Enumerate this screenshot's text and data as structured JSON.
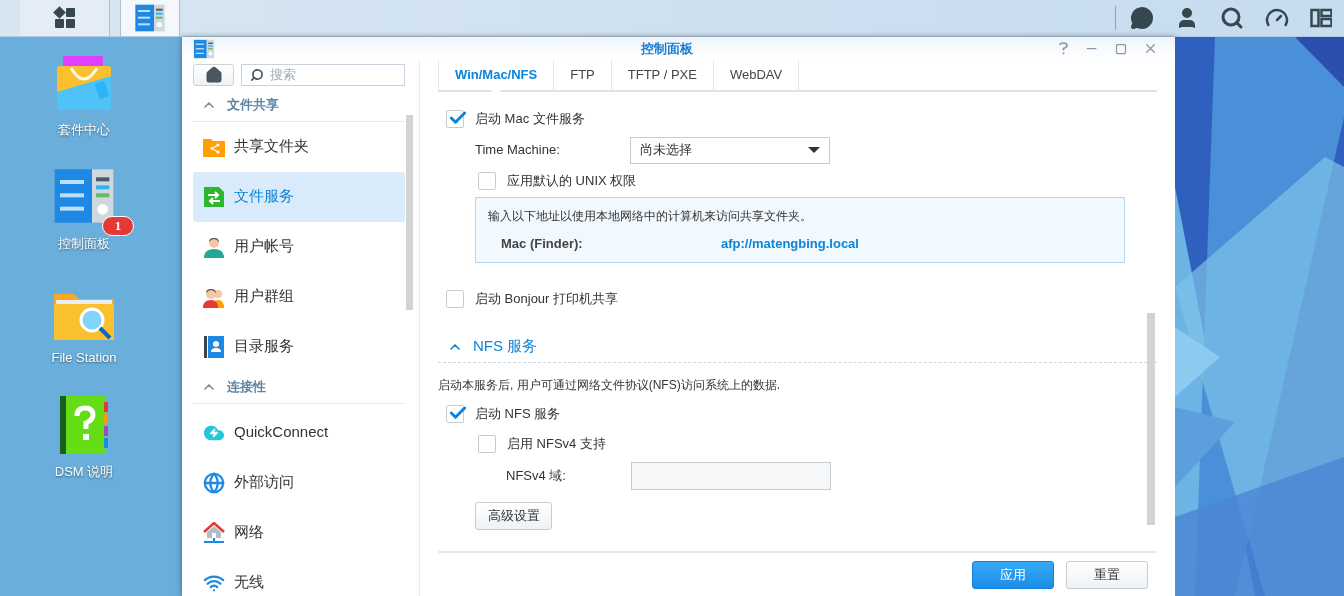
{
  "taskbar": {
    "left_buttons": [
      {
        "kind": "main-menu",
        "selected": false
      },
      {
        "kind": "control-panel",
        "selected": true
      }
    ]
  },
  "desktop_icons": [
    {
      "kind": "package",
      "label": "套件中心"
    },
    {
      "kind": "control",
      "label": "控制面板",
      "badge": "1"
    },
    {
      "kind": "folder",
      "label": "File Station"
    },
    {
      "kind": "help",
      "label": "DSM 说明"
    }
  ],
  "window": {
    "title": "控制面板"
  },
  "sidebar": {
    "search": {
      "placeholder": "搜索"
    },
    "sections": [
      {
        "title": "文件共享",
        "expanded": true,
        "items": [
          {
            "label": "共享文件夹",
            "selected": false
          },
          {
            "label": "文件服务",
            "selected": true
          },
          {
            "label": "用户帐号",
            "selected": false
          },
          {
            "label": "用户群组",
            "selected": false
          },
          {
            "label": "目录服务",
            "selected": false
          }
        ]
      },
      {
        "title": "连接性",
        "expanded": true,
        "items": [
          {
            "label": "QuickConnect",
            "selected": false
          },
          {
            "label": "外部访问",
            "selected": false
          },
          {
            "label": "网络",
            "selected": false
          },
          {
            "label": "无线",
            "selected": false
          }
        ]
      }
    ]
  },
  "tabs": [
    {
      "label": "Win/Mac/NFS",
      "selected": true
    },
    {
      "label": "FTP",
      "selected": false
    },
    {
      "label": "TFTP / PXE",
      "selected": false
    },
    {
      "label": "WebDAV",
      "selected": false
    }
  ],
  "mac": {
    "enable": {
      "label": "启动 Mac 文件服务",
      "checked": true
    },
    "time_machine": {
      "label": "Time Machine:",
      "value": "尚未选择"
    },
    "unix": {
      "label": "应用默认的 UNIX 权限",
      "checked": false
    },
    "info": {
      "text": "输入以下地址以使用本地网络中的计算机来访问共享文件夹。",
      "key": "Mac (Finder):",
      "value": "afp://matengbing.local"
    }
  },
  "bonjour": {
    "label": "启动 Bonjour 打印机共享",
    "checked": false
  },
  "nfs": {
    "title": "NFS 服务",
    "expanded": true,
    "description": "启动本服务后, 用户可通过网络文件协议(NFS)访问系统上的数据.",
    "enable": {
      "label": "启动 NFS 服务",
      "checked": true
    },
    "v4": {
      "label": "启用 NFSv4 支持",
      "checked": false
    },
    "domain": {
      "label": "NFSv4 域:"
    },
    "advanced_button": "高级设置"
  },
  "footer": {
    "buttons": [
      {
        "kind": "primary",
        "label": "应用"
      },
      {
        "kind": "secondary",
        "label": "重置"
      }
    ]
  }
}
